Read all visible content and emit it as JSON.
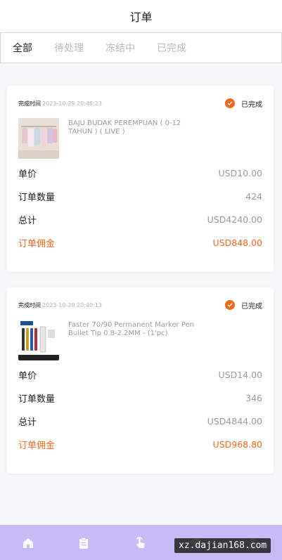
{
  "header": {
    "title": "订单"
  },
  "tabs": [
    {
      "label": "全部"
    },
    {
      "label": "待处理"
    },
    {
      "label": "冻结中"
    },
    {
      "label": "已完成"
    }
  ],
  "orders": [
    {
      "time_label": "完成时间",
      "time": "2023-10-29 20:48:23",
      "status": "已完成",
      "product_name": "BAJU BUDAK PEREMPUAN ( 0-12 TAHUN ) ( LIVE )",
      "unit_price_label": "单价",
      "unit_price": "USD10.00",
      "quantity_label": "订单数量",
      "quantity": "424",
      "total_label": "总计",
      "total": "USD4240.00",
      "commission_label": "订单佣金",
      "commission": "USD848.00"
    },
    {
      "time_label": "完成时间",
      "time": "2023-10-29 20:40:13",
      "status": "已完成",
      "product_name": "Faster 70/90 Permanent Marker Pen Bullet Tip 0.8-2.2MM - (1'pc)",
      "unit_price_label": "单价",
      "unit_price": "USD14.00",
      "quantity_label": "订单数量",
      "quantity": "346",
      "total_label": "总计",
      "total": "USD4844.00",
      "commission_label": "订单佣金",
      "commission": "USD968.80"
    }
  ],
  "bottom_nav": [
    {
      "icon": "home-icon"
    },
    {
      "icon": "clipboard-icon"
    },
    {
      "icon": "tap-hand-icon"
    },
    {
      "icon": "chat-icon"
    },
    {
      "icon": "user-icon"
    }
  ],
  "watermark": "xz.dajian168.com",
  "colors": {
    "accent": "#ef6a1f",
    "nav_bg": "#c8bbf5"
  }
}
